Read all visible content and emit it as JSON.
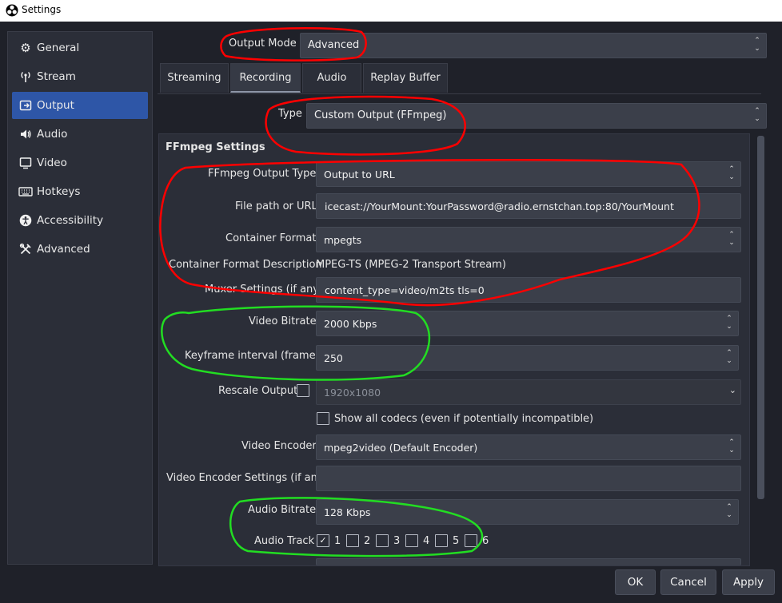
{
  "window": {
    "title": "Settings"
  },
  "sidebar": {
    "items": [
      {
        "label": "General",
        "icon": "gear-icon"
      },
      {
        "label": "Stream",
        "icon": "antenna-icon"
      },
      {
        "label": "Output",
        "icon": "output-icon",
        "active": true
      },
      {
        "label": "Audio",
        "icon": "speaker-icon"
      },
      {
        "label": "Video",
        "icon": "monitor-icon"
      },
      {
        "label": "Hotkeys",
        "icon": "keyboard-icon"
      },
      {
        "label": "Accessibility",
        "icon": "accessibility-icon"
      },
      {
        "label": "Advanced",
        "icon": "tools-icon"
      }
    ]
  },
  "output_mode": {
    "label": "Output Mode",
    "value": "Advanced"
  },
  "tabs": [
    {
      "label": "Streaming"
    },
    {
      "label": "Recording",
      "active": true
    },
    {
      "label": "Audio"
    },
    {
      "label": "Replay Buffer"
    }
  ],
  "recording": {
    "type_label": "Type",
    "type_value": "Custom Output (FFmpeg)"
  },
  "ffmpeg": {
    "group_title": "FFmpeg Settings",
    "output_type_label": "FFmpeg Output Type",
    "output_type_value": "Output to URL",
    "path_label": "File path or URL",
    "path_value": "icecast://YourMount:YourPassword@radio.ernstchan.top:80/YourMount",
    "container_label": "Container Format",
    "container_value": "mpegts",
    "container_desc_label": "Container Format Description",
    "container_desc_value": "MPEG-TS (MPEG-2 Transport Stream)",
    "muxer_label": "Muxer Settings (if any)",
    "muxer_value": "content_type=video/m2ts tls=0",
    "video_bitrate_label": "Video Bitrate",
    "video_bitrate_value": "2000 Kbps",
    "keyframe_label": "Keyframe interval (frames)",
    "keyframe_value": "250",
    "rescale_label": "Rescale Output",
    "rescale_checked": false,
    "rescale_value": "1920x1080",
    "show_codecs_label": "Show all codecs (even if potentially incompatible)",
    "show_codecs_checked": false,
    "encoder_label": "Video Encoder",
    "encoder_value": "mpeg2video (Default Encoder)",
    "encoder_settings_label": "Video Encoder Settings (if any)",
    "encoder_settings_value": "",
    "audio_bitrate_label": "Audio Bitrate",
    "audio_bitrate_value": "128 Kbps",
    "audio_track_label": "Audio Track",
    "audio_tracks": [
      {
        "label": "1",
        "checked": true
      },
      {
        "label": "2",
        "checked": false
      },
      {
        "label": "3",
        "checked": false
      },
      {
        "label": "4",
        "checked": false
      },
      {
        "label": "5",
        "checked": false
      },
      {
        "label": "6",
        "checked": false
      }
    ]
  },
  "buttons": {
    "ok": "OK",
    "cancel": "Cancel",
    "apply": "Apply"
  },
  "annotation_colors": {
    "red": "#ff0000",
    "green": "#22dd22",
    "accent": "#2e56a7"
  }
}
